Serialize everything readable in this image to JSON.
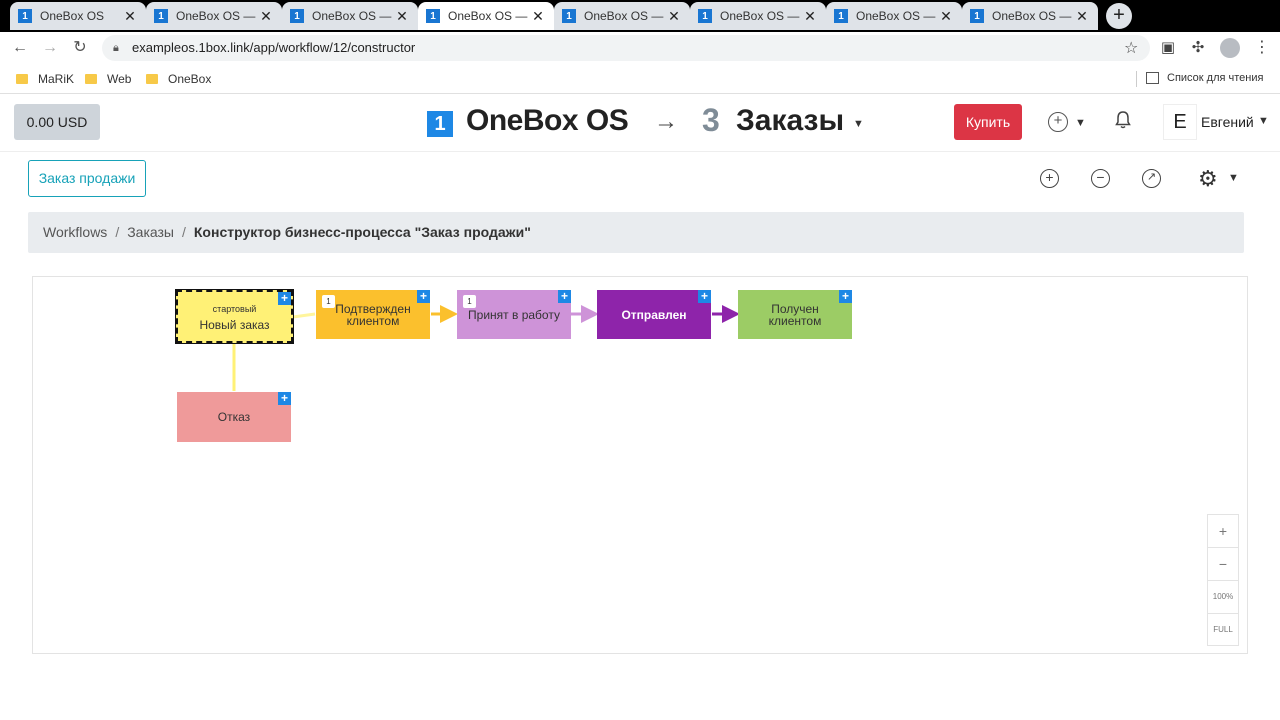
{
  "browser": {
    "tabs": [
      {
        "title": "OneBox OS"
      },
      {
        "title": "OneBox OS — Ан"
      },
      {
        "title": "OneBox OS — С"
      },
      {
        "title": "OneBox OS — З"
      },
      {
        "title": "OneBox OS — Ан"
      },
      {
        "title": "OneBox OS — Ан"
      },
      {
        "title": "OneBox OS — С"
      },
      {
        "title": "OneBox OS — С"
      }
    ],
    "active_tab": 3,
    "url": "exampleos.1box.link/app/workflow/12/constructor",
    "bookmarks": [
      "MaRiK",
      "Web",
      "OneBox"
    ],
    "reading_list": "Список для чтения"
  },
  "header": {
    "balance": "0.00 USD",
    "logo_badge": "1",
    "logo_text": "OneBox OS",
    "workspace_number": "3",
    "workspace_name": "Заказы",
    "buy_label": "Купить",
    "avatar_letter": "E",
    "user_name": "Евгений"
  },
  "toolbar": {
    "process_button": "Заказ продажи"
  },
  "breadcrumb": {
    "items": [
      "Workflows",
      "Заказы"
    ],
    "current": "Конструктор бизнесс-процесса \"Заказ продажи\""
  },
  "workflow": {
    "nodes": [
      {
        "id": "new",
        "label": "Новый заказ",
        "sublabel": "стартовый",
        "color": "#fff176",
        "count": ""
      },
      {
        "id": "confirmed",
        "label": "Подтвержден клиентом",
        "sublabel": "",
        "color": "#fbc02d",
        "count": "1"
      },
      {
        "id": "in-work",
        "label": "Принят в работу",
        "sublabel": "",
        "color": "#ce93d8",
        "count": "1"
      },
      {
        "id": "sent",
        "label": "Отправлен",
        "sublabel": "",
        "color": "#8e24aa",
        "count": ""
      },
      {
        "id": "received",
        "label": "Получен клиентом",
        "sublabel": "",
        "color": "#9ccc65",
        "count": ""
      },
      {
        "id": "rejected",
        "label": "Отказ",
        "sublabel": "",
        "color": "#ef9a9a",
        "count": ""
      }
    ],
    "node_plus": "+"
  },
  "zoom": {
    "plus": "+",
    "minus": "−",
    "level": "100%",
    "full": "FULL"
  }
}
